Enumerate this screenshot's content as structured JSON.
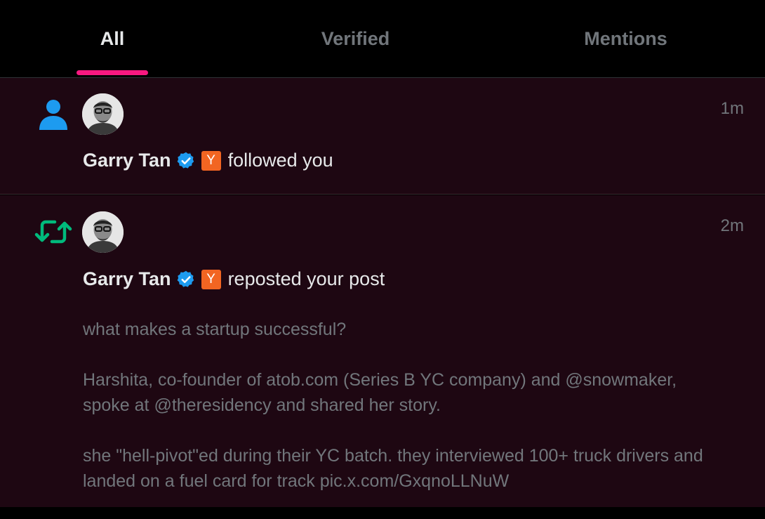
{
  "tabs": {
    "all": "All",
    "verified": "Verified",
    "mentions": "Mentions"
  },
  "notifications": [
    {
      "type_icon": "person-icon",
      "time": "1m",
      "name": "Garry Tan",
      "badge": "Y",
      "action": "followed you"
    },
    {
      "type_icon": "repost-icon",
      "time": "2m",
      "name": "Garry Tan",
      "badge": "Y",
      "action": "reposted your post",
      "post": {
        "line1": "what makes a startup successful?",
        "line2": "Harshita, co-founder of atob.com (Series B YC company) and @snowmaker, spoke at @theresidency and shared her story.",
        "line3": "she \"hell-pivot\"ed during their YC batch. they interviewed 100+ truck drivers and landed on a fuel card for track pic.x.com/GxqnoLLNuW"
      }
    }
  ],
  "colors": {
    "accent": "#f91880",
    "verified": "#1d9bf0",
    "repost": "#00ba7c",
    "yc": "#f26522",
    "row_bg": "#1e0712"
  }
}
